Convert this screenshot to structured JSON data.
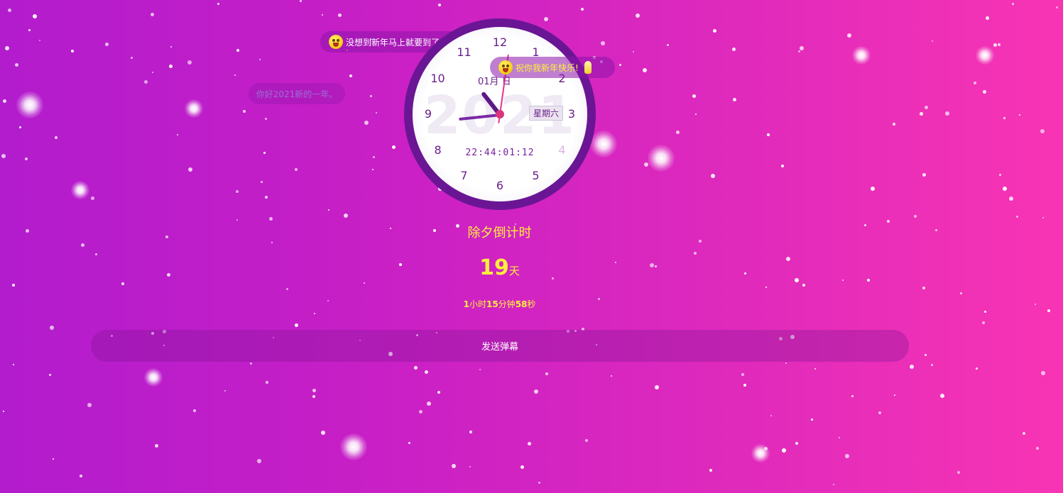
{
  "danmu": [
    {
      "text": "没想到新年马上就要到了",
      "color": "#ffffff",
      "emoji": "tongue-face-icon",
      "thumb": "thumbs-up-icon"
    },
    {
      "text": "祝你我新年快乐!",
      "color": "#ffef3b",
      "emoji": "tongue-face-icon",
      "thumb": "thumbs-up-icon"
    },
    {
      "text": "你好2021新的一年。",
      "color": "#9b6fd6"
    }
  ],
  "clock": {
    "year": "2021",
    "date": "01月  日",
    "weekday": "星期六",
    "digital": "22:44:01:12",
    "numbers": [
      "12",
      "1",
      "2",
      "3",
      "4",
      "5",
      "6",
      "7",
      "8",
      "9",
      "10",
      "11"
    ],
    "colors": {
      "ring": "#6a1694",
      "numbers": "#6a1f8a",
      "second_hand": "#e8348d"
    }
  },
  "countdown": {
    "title": "除夕倒计时",
    "days": "19",
    "days_unit": "天",
    "hours": "1",
    "hours_unit": "小时",
    "minutes": "15",
    "minutes_unit": "分钟",
    "seconds": "58",
    "seconds_unit": "秒"
  },
  "send_button": {
    "label": "发送弹幕"
  },
  "colors": {
    "accent_text": "#ffef3b",
    "background_start": "#b21ccd",
    "background_end": "#f834b4"
  }
}
